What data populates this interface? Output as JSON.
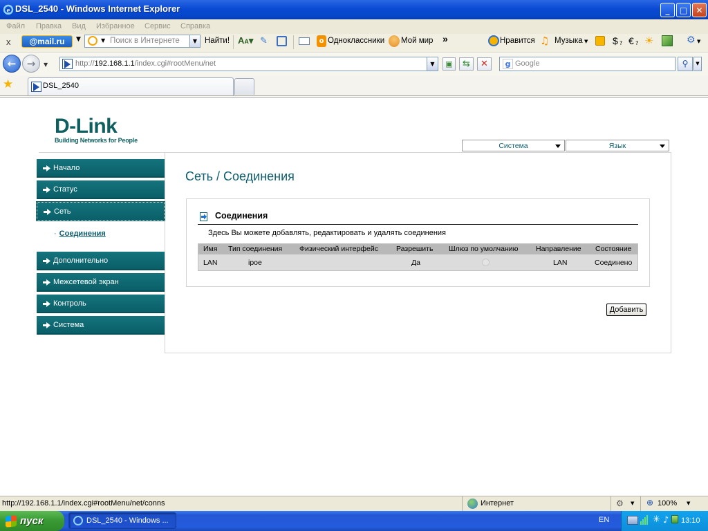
{
  "window": {
    "title": "DSL_2540 - Windows Internet Explorer",
    "controls": [
      "_",
      "□",
      "✕"
    ]
  },
  "menubar": [
    "Файл",
    "Правка",
    "Вид",
    "Избранное",
    "Сервис",
    "Справка"
  ],
  "mailtoolbar": {
    "close": "x",
    "brand": "@mail.ru",
    "search_placeholder": "Поиск в Интернете",
    "find_button": "Найти!",
    "odnoklassniki": "Одноклассники",
    "moimir": "Мой мир",
    "more": "»",
    "like": "Нравится",
    "music": "Музыка",
    "dollar": "$",
    "euro": "€"
  },
  "addressbar": {
    "url_prefix": "http://",
    "url_host": "192.168.1.1",
    "url_path": "/index.cgi#rootMenu/net",
    "search_placeholder": "Google"
  },
  "tabs": [
    {
      "label": "DSL_2540"
    }
  ],
  "router": {
    "logo_main": "D-Link",
    "logo_tagline": "Building Networks for People",
    "top_selects": {
      "system": "Система",
      "language": "Язык"
    },
    "menu": [
      {
        "label": "Начало"
      },
      {
        "label": "Статус"
      },
      {
        "label": "Сеть"
      },
      {
        "label": "Дополнительно"
      },
      {
        "label": "Межсетевой экран"
      },
      {
        "label": "Контроль"
      },
      {
        "label": "Система"
      }
    ],
    "submenu_item": "Соединения",
    "page_title": "Сеть /  Соединения",
    "panel": {
      "title": "Соединения",
      "description": "Здесь Вы можете добавлять, редактировать и удалять соединения"
    },
    "table": {
      "headers": [
        "Имя",
        "Тип соединения",
        "Физический интерфейс",
        "Разрешить",
        "Шлюз по умолчанию",
        "Направление",
        "Состояние"
      ],
      "rows": [
        {
          "name": "LAN",
          "type": "ipoe",
          "iface": "",
          "enabled": "Да",
          "direction": "LAN",
          "state": "Соединено"
        }
      ]
    },
    "add_button": "Добавить"
  },
  "statusbar": {
    "url": "http://192.168.1.1/index.cgi#rootMenu/net/conns",
    "zone": "Интернет",
    "zoom": "100%"
  },
  "taskbar": {
    "start": "пуск",
    "task": "DSL_2540 - Windows ...",
    "lang": "EN",
    "time": "13:10"
  },
  "colors": {
    "accent": "#0d5e6e",
    "menu_bg": "#0e6a73",
    "xp_blue": "#0a4ad4",
    "start_green": "#3a9b35"
  }
}
